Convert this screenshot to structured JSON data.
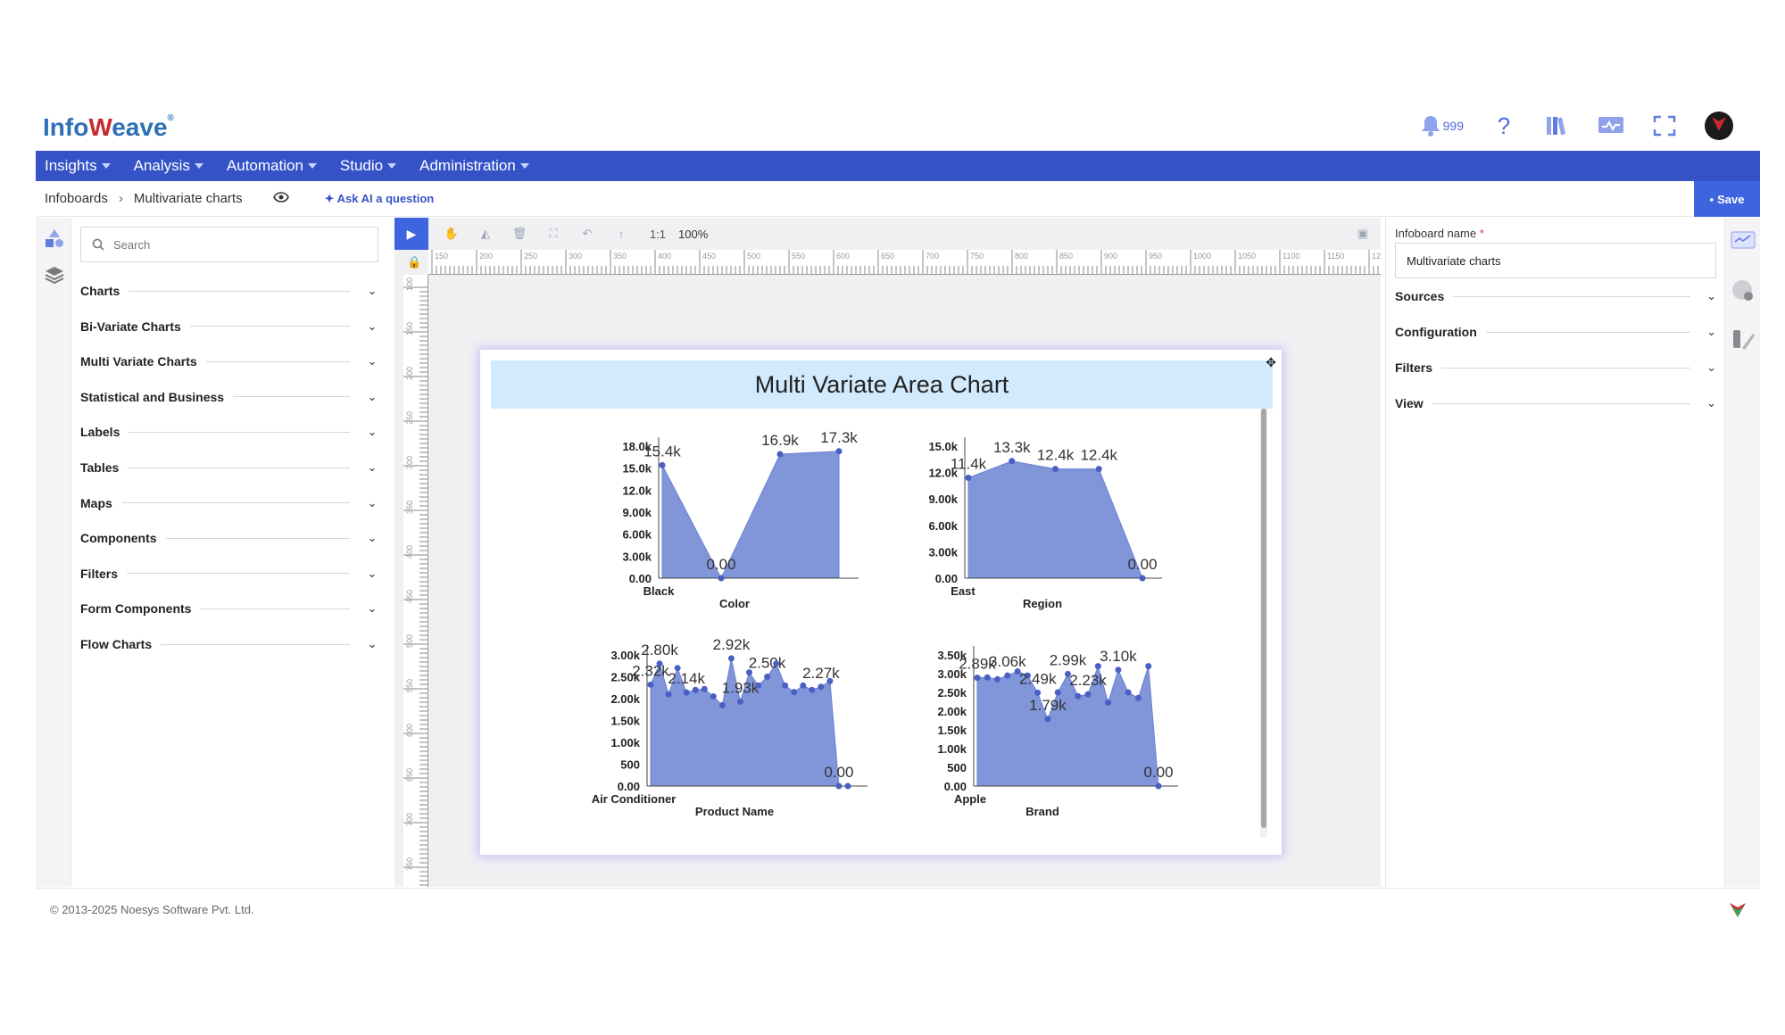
{
  "app": {
    "logo_text": "Info",
    "logo_text2": "eave",
    "notification_count": "999"
  },
  "nav": {
    "items": [
      "Insights",
      "Analysis",
      "Automation",
      "Studio",
      "Administration"
    ]
  },
  "breadcrumb": {
    "root": "Infoboards",
    "current": "Multivariate charts",
    "ask_ai": "Ask AI a question",
    "save": "Save"
  },
  "left_panel": {
    "search_placeholder": "Search",
    "sections": [
      "Charts",
      "Bi-Variate Charts",
      "Multi Variate Charts",
      "Statistical and Business",
      "Labels",
      "Tables",
      "Maps",
      "Components",
      "Filters",
      "Form Components",
      "Flow Charts"
    ]
  },
  "toolbar": {
    "ratio": "1:1",
    "zoom": "100%"
  },
  "right_panel": {
    "name_label": "Infoboard name",
    "name_value": "Multivariate charts",
    "sections": [
      "Sources",
      "Configuration",
      "Filters",
      "View"
    ]
  },
  "footer": {
    "copyright": "© 2013-2025 Noesys Software Pvt. Ltd."
  },
  "colors": {
    "nav_bg": "#3553c7",
    "accent": "#3f64e0",
    "area_fill": "#8195d9",
    "point": "#4a5fc4",
    "title_bg": "#d2eafd"
  },
  "chart_data": {
    "title": "Multi Variate Area Chart",
    "type": "area",
    "panels": [
      {
        "xlabel": "Color",
        "first_category": "Black",
        "y_ticks": [
          "0.00",
          "3.00k",
          "6.00k",
          "9.00k",
          "12.0k",
          "15.0k",
          "18.0k"
        ],
        "ymax": 18000,
        "values": [
          15400,
          0,
          16900,
          17300
        ],
        "labels": [
          "15.4k",
          "0.00",
          "16.9k",
          "17.3k"
        ]
      },
      {
        "xlabel": "Region",
        "first_category": "East",
        "y_ticks": [
          "0.00",
          "3.00k",
          "6.00k",
          "9.00k",
          "12.0k",
          "15.0k"
        ],
        "ymax": 15000,
        "values": [
          11400,
          13300,
          12400,
          12400,
          0
        ],
        "labels": [
          "11.4k",
          "13.3k",
          "12.4k",
          "12.4k",
          "0.00"
        ]
      },
      {
        "xlabel": "Product Name",
        "first_category": "Air Conditioner",
        "y_ticks": [
          "0.00",
          "500",
          "1.00k",
          "1.50k",
          "2.00k",
          "2.50k",
          "3.00k"
        ],
        "ymax": 3000,
        "values": [
          2320,
          2800,
          2100,
          2700,
          2140,
          2200,
          2220,
          2050,
          1850,
          2920,
          1930,
          2600,
          2300,
          2500,
          2800,
          2300,
          2150,
          2300,
          2200,
          2270,
          2400,
          0,
          0
        ],
        "labels": [
          "2.32k",
          "2.80k",
          "",
          "",
          "2.14k",
          "",
          "",
          "",
          "",
          "2.92k",
          "1.93k",
          "",
          "",
          "2.50k",
          "",
          "",
          "",
          "",
          "",
          "2.27k",
          "",
          "0.00",
          ""
        ]
      },
      {
        "xlabel": "Brand",
        "first_category": "Apple",
        "y_ticks": [
          "0.00",
          "500",
          "1.00k",
          "1.50k",
          "2.00k",
          "2.50k",
          "3.00k",
          "3.50k"
        ],
        "ymax": 3500,
        "values": [
          2890,
          2900,
          2850,
          2950,
          3060,
          2950,
          2490,
          1790,
          2500,
          2990,
          2400,
          2450,
          3200,
          2230,
          3100,
          2500,
          2350,
          3200,
          0
        ],
        "labels": [
          "2.89k",
          "",
          "",
          "3.06k",
          "",
          "",
          "2.49k",
          "1.79k",
          "",
          "2.99k",
          "",
          "2.23k",
          "",
          "",
          "3.10k",
          "",
          "",
          "",
          "0.00"
        ]
      }
    ]
  }
}
